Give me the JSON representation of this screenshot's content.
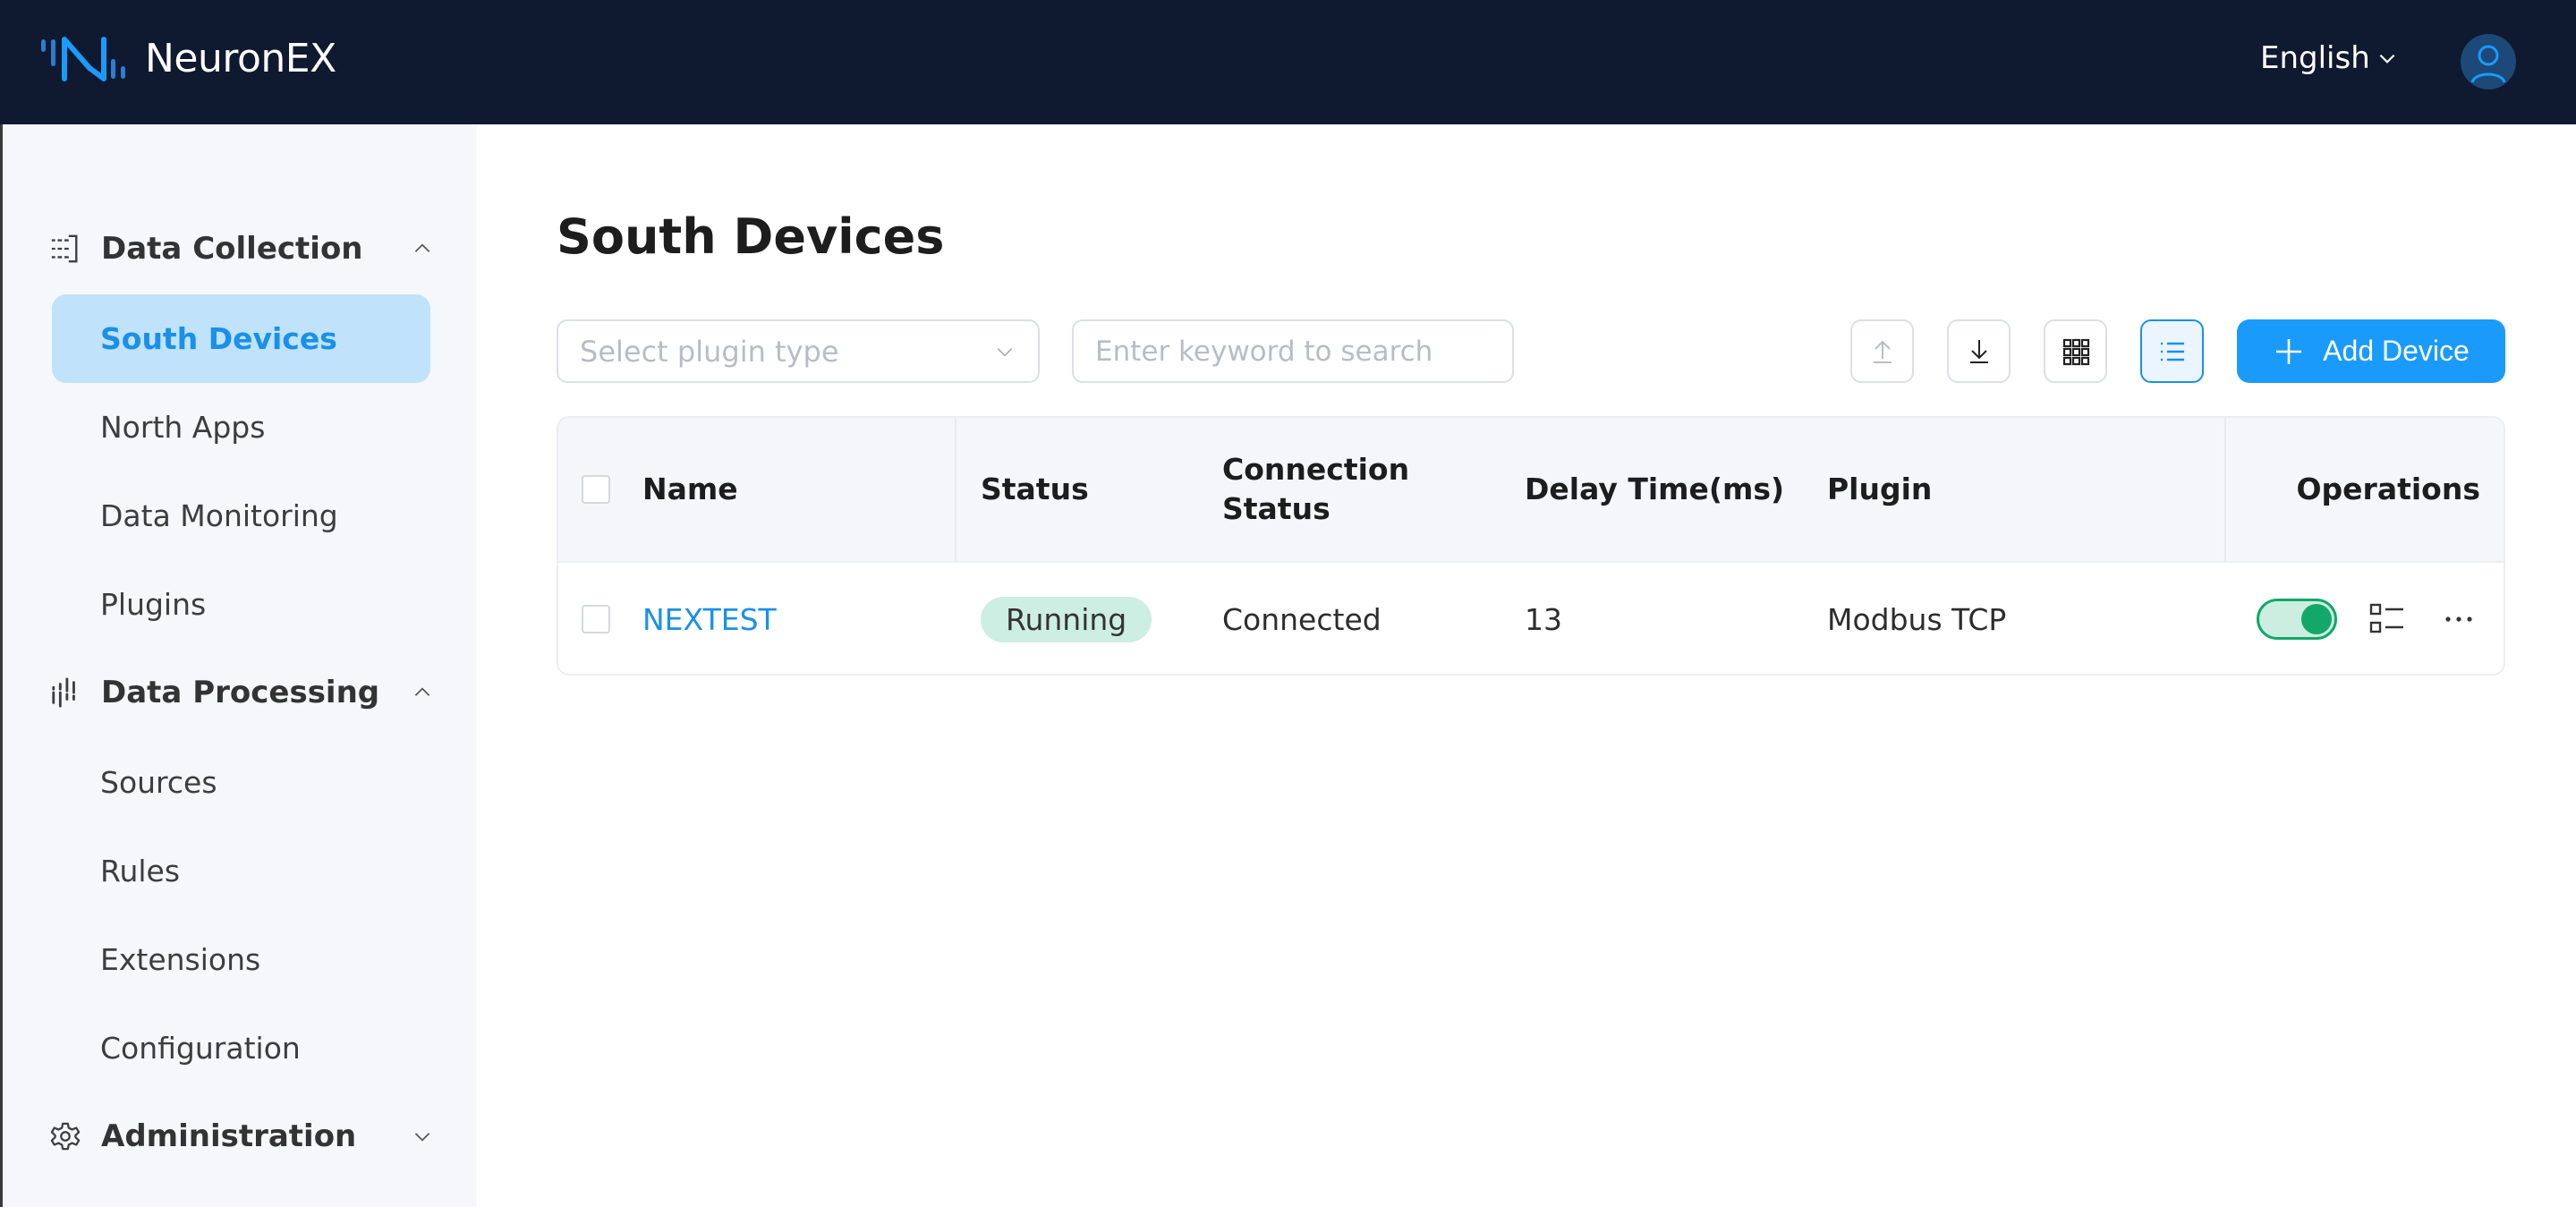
{
  "header": {
    "brand": "NeuronEX",
    "language": "English",
    "colors": {
      "background": "#0f1930",
      "accent": "#1a9bfc"
    }
  },
  "sidebar": {
    "groups": [
      {
        "title": "Data Collection",
        "icon": "data-collection-icon",
        "expanded": true,
        "items": [
          {
            "label": "South Devices",
            "active": true
          },
          {
            "label": "North Apps",
            "active": false
          },
          {
            "label": "Data Monitoring",
            "active": false
          },
          {
            "label": "Plugins",
            "active": false
          }
        ]
      },
      {
        "title": "Data Processing",
        "icon": "data-processing-icon",
        "expanded": true,
        "items": [
          {
            "label": "Sources",
            "active": false
          },
          {
            "label": "Rules",
            "active": false
          },
          {
            "label": "Extensions",
            "active": false
          },
          {
            "label": "Configuration",
            "active": false
          }
        ]
      },
      {
        "title": "Administration",
        "icon": "gear-icon",
        "expanded": false,
        "items": []
      }
    ]
  },
  "main": {
    "title": "South Devices",
    "filters": {
      "plugin_select_placeholder": "Select plugin type",
      "plugin_select_value": "",
      "search_placeholder": "Enter keyword to search",
      "search_value": ""
    },
    "toolbar": {
      "import_icon": "upload-icon",
      "export_icon": "download-icon",
      "card_view_icon": "grid-icon",
      "list_view_icon": "list-icon",
      "selected_view": "list",
      "add_label": "Add Device"
    },
    "table": {
      "columns": [
        "Name",
        "Status",
        "Connection Status",
        "Delay Time(ms)",
        "Plugin",
        "Operations"
      ],
      "column_labels": {
        "name": "Name",
        "status": "Status",
        "connection_line1": "Connection",
        "connection_line2": "Status",
        "delay": "Delay Time(ms)",
        "plugin": "Plugin",
        "operations": "Operations"
      },
      "rows": [
        {
          "name": "NEXTEST",
          "status": "Running",
          "connection_status": "Connected",
          "delay_ms": "13",
          "plugin": "Modbus TCP",
          "enabled": true
        }
      ]
    }
  }
}
